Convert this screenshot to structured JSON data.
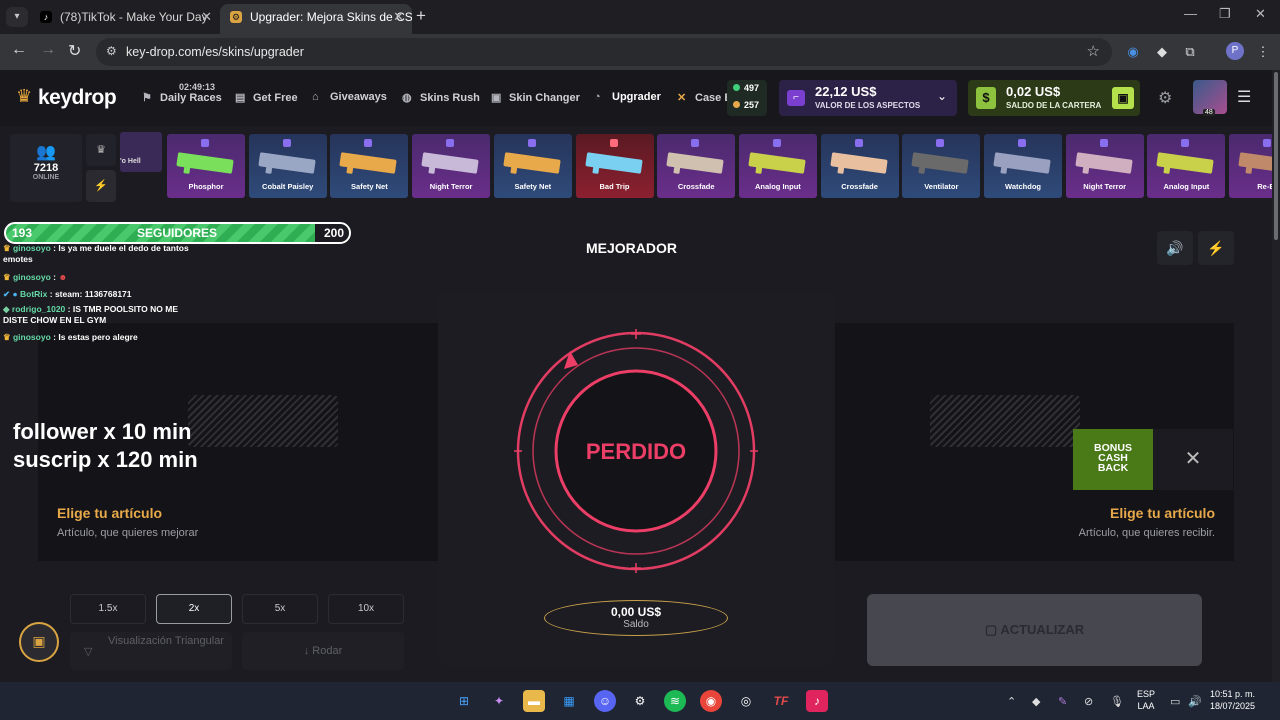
{
  "browser": {
    "tabs": [
      {
        "label": "(78)TikTok - Make Your Day",
        "icon": "tiktok-icon"
      },
      {
        "label": "Upgrader: Mejora Skins de CS2",
        "icon": "keydrop-icon"
      }
    ],
    "url": "key-drop.com/es/skins/upgrader",
    "profile_initial": "P"
  },
  "site": {
    "logo": "keydrop",
    "race_timer": "02:49:13",
    "nav": [
      {
        "label": "Daily Races",
        "icon": "flag-icon"
      },
      {
        "label": "Get Free",
        "icon": "gift-box-icon"
      },
      {
        "label": "Giveaways",
        "icon": "gift-icon"
      },
      {
        "label": "Skins Rush",
        "icon": "rush-icon"
      },
      {
        "label": "Skin Changer",
        "icon": "swap-icon"
      },
      {
        "label": "Upgrader",
        "icon": "upgrade-icon"
      },
      {
        "label": "Case B",
        "icon": "cases-icon"
      }
    ],
    "gems": {
      "green": "497",
      "gold": "257"
    },
    "skins_value": {
      "amount": "22,12 US$",
      "label": "VALOR DE LOS ASPECTOS"
    },
    "wallet": {
      "amount": "0,02 US$",
      "label": "SALDO DE LA CARTERA"
    },
    "avatar_level": "48"
  },
  "drops": {
    "online_count": "7218",
    "online_label": "ONLINE",
    "partial_item": "'o Hell",
    "items": [
      {
        "name": "Phosphor",
        "rarity": "purple"
      },
      {
        "name": "Cobalt Paisley",
        "rarity": "blue"
      },
      {
        "name": "Safety Net",
        "rarity": "blue"
      },
      {
        "name": "Night Terror",
        "rarity": "purple"
      },
      {
        "name": "Safety Net",
        "rarity": "blue"
      },
      {
        "name": "Bad Trip",
        "rarity": "red"
      },
      {
        "name": "Crossfade",
        "rarity": "purple"
      },
      {
        "name": "Analog Input",
        "rarity": "purple"
      },
      {
        "name": "Crossfade",
        "rarity": "blue"
      },
      {
        "name": "Ventilator",
        "rarity": "blue"
      },
      {
        "name": "Watchdog",
        "rarity": "blue"
      },
      {
        "name": "Night Terror",
        "rarity": "purple"
      },
      {
        "name": "Analog Input",
        "rarity": "purple"
      },
      {
        "name": "Re-En",
        "rarity": "purple"
      }
    ]
  },
  "upgrader": {
    "title": "MEJORADOR",
    "result": "PERDIDO",
    "balance": "0,00 US$",
    "balance_label": "Saldo",
    "left": {
      "title": "Elige tu artículo",
      "subtitle": "Artículo, que quieres mejorar"
    },
    "right": {
      "title": "Elige tu artículo",
      "subtitle": "Artículo, que quieres recibir."
    },
    "multipliers": [
      "1.5x",
      "2x",
      "5x",
      "10x"
    ],
    "selected_multiplier": "2x",
    "triangular_label": "Visualización Triangular",
    "roll_label": "Rodar",
    "upgrade_button": "ACTUALIZAR",
    "bonus": [
      "BONUS",
      "CASH",
      "BACK"
    ]
  },
  "overlay": {
    "followers_current": "193",
    "followers_label": "SEGUIDORES",
    "followers_goal": "200",
    "followers_progress": 0.965,
    "chat": [
      {
        "user": "ginosoyo",
        "text": ": Is ya me duele el dedo de tantos",
        "cont": "emotes"
      },
      {
        "user": "ginosoyo",
        "text": ":"
      },
      {
        "user": "BotRix",
        "text": ": steam: 1136768171"
      },
      {
        "user": "rodrigo_1020",
        "text": ": IS TMR POOLSITO NO ME",
        "cont": "DISTE CHOW EN EL GYM"
      },
      {
        "user": "ginosoyo",
        "text": ": Is estas pero alegre"
      }
    ],
    "text_line1": "follower x 10 min",
    "text_line2": "suscrip x 120 min"
  },
  "taskbar": {
    "lang_top": "ESP",
    "lang_bottom": "LAA",
    "time": "10:51 p. m.",
    "date": "18/07/2025"
  },
  "colors": {
    "accent_gold": "#e8a94a",
    "lost_red": "#ec3e66",
    "wallet_green": "#8dc23f"
  }
}
